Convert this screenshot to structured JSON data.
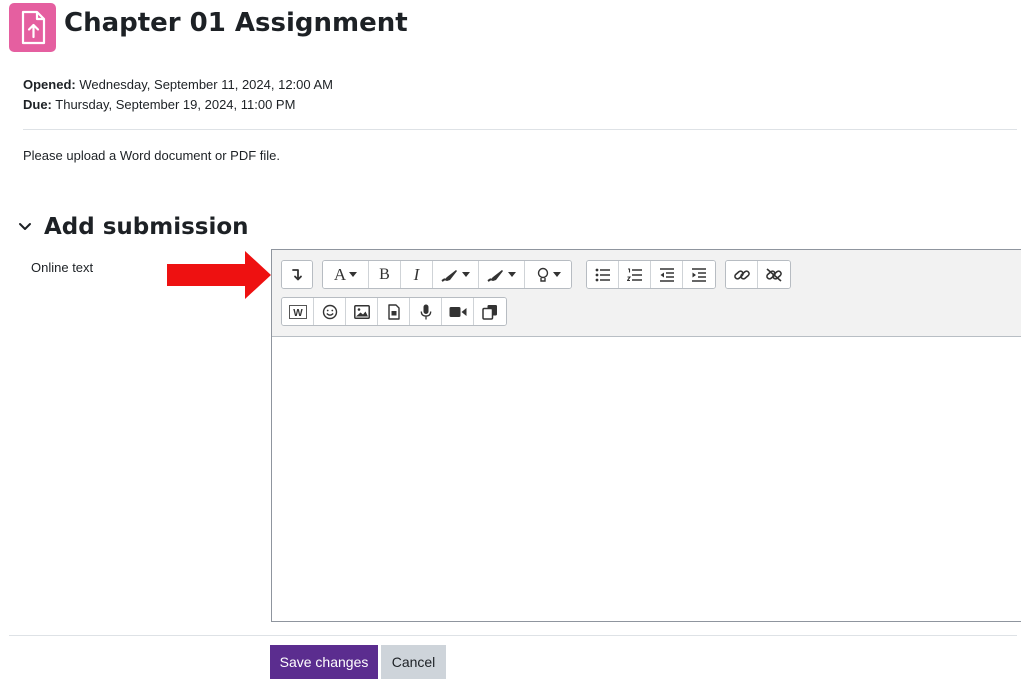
{
  "header": {
    "title": "Chapter 01 Assignment",
    "icon": "file-upload-icon",
    "icon_color": "#e55fa0"
  },
  "dates": {
    "opened_label": "Opened:",
    "opened_value": " Wednesday, September 11, 2024, 12:00 AM",
    "due_label": "Due:",
    "due_value": " Thursday, September 19, 2024, 11:00 PM"
  },
  "intro": "Please upload a Word document or PDF file.",
  "section": {
    "title": "Add submission"
  },
  "form": {
    "online_text_label": "Online text"
  },
  "toolbar": {
    "row1_icons": [
      "show-more-icon",
      "font-color-icon",
      "bold-icon",
      "italic-icon",
      "text-highlight-icon",
      "background-color-icon",
      "accessibility-checker-icon",
      "unordered-list-icon",
      "ordered-list-icon",
      "outdent-icon",
      "indent-icon",
      "link-icon",
      "unlink-icon"
    ],
    "row2_icons": [
      "word-import-icon",
      "emoji-icon",
      "image-icon",
      "media-icon",
      "record-audio-icon",
      "record-video-icon",
      "copy-icon"
    ],
    "font_letter": "A",
    "bold_letter": "B",
    "italic_letter": "I"
  },
  "buttons": {
    "save": "Save changes",
    "cancel": "Cancel"
  },
  "colors": {
    "primary": "#5b2d8f",
    "secondary": "#ced4da",
    "annotation_arrow": "#ee1111"
  }
}
